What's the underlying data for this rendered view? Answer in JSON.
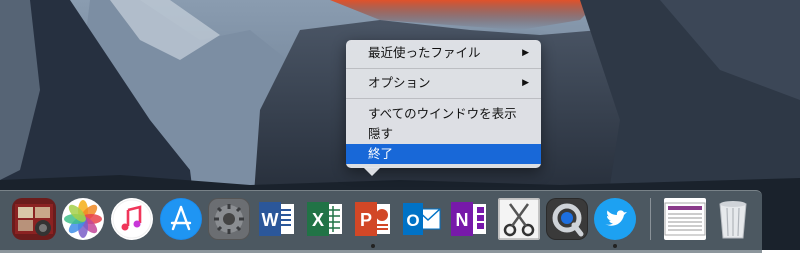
{
  "context_menu": {
    "recent_files": "最近使ったファイル",
    "options": "オプション",
    "show_all_windows": "すべてのウインドウを表示",
    "hide": "隠す",
    "quit": "終了",
    "submenu_arrow": "▶",
    "selected_item": "quit"
  },
  "dock": {
    "apps": [
      {
        "name": "photo-booth",
        "running": false
      },
      {
        "name": "photos",
        "running": false
      },
      {
        "name": "itunes",
        "running": false
      },
      {
        "name": "app-store",
        "running": false
      },
      {
        "name": "system-preferences",
        "running": false
      },
      {
        "name": "microsoft-word",
        "letter": "W",
        "running": false
      },
      {
        "name": "microsoft-excel",
        "letter": "X",
        "running": false
      },
      {
        "name": "microsoft-powerpoint",
        "letter": "P",
        "running": true
      },
      {
        "name": "microsoft-outlook",
        "letter": "O",
        "running": false
      },
      {
        "name": "microsoft-onenote",
        "letter": "N",
        "running": false
      },
      {
        "name": "scissors-utility",
        "running": false
      },
      {
        "name": "quicktime",
        "running": false
      },
      {
        "name": "twitter",
        "running": true
      },
      {
        "name": "document-preview",
        "running": false
      },
      {
        "name": "trash",
        "running": false
      }
    ],
    "colors": {
      "word": "#2b579a",
      "excel": "#217346",
      "powerpoint": "#d24726",
      "outlook": "#0072c6",
      "onenote": "#7719aa",
      "twitter": "#1da1f2",
      "selection": "#1868d8"
    }
  }
}
